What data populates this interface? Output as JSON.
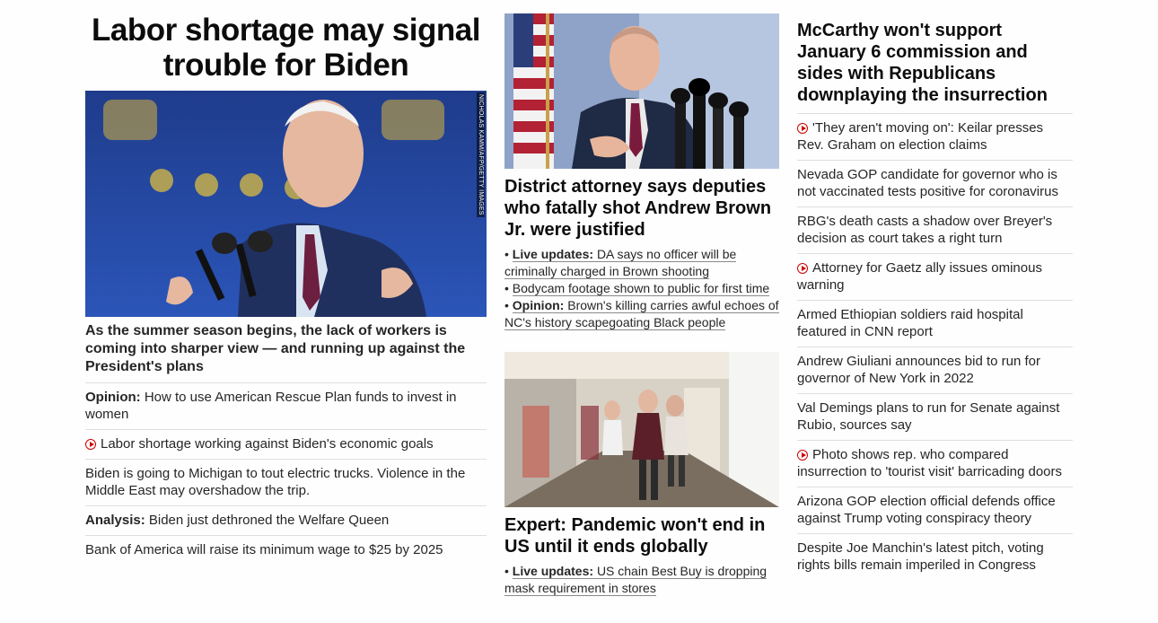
{
  "lead": {
    "headline": "Labor shortage may signal trouble for Biden",
    "photo_credit": "NICHOLAS KAMM/AFP/GETTY IMAGES",
    "summary": "As the summer season begins, the lack of workers is coming into sharper view — and running up against the President's plans",
    "links": [
      {
        "prefix": "Opinion:",
        "text": "How to use American Rescue Plan funds to invest in women",
        "video": false
      },
      {
        "prefix": "",
        "text": "Labor shortage working against Biden's economic goals",
        "video": true
      },
      {
        "prefix": "",
        "text": "Biden is going to Michigan to tout electric trucks. Violence in the Middle East may overshadow the trip.",
        "video": false
      },
      {
        "prefix": "Analysis:",
        "text": "Biden just dethroned the Welfare Queen",
        "video": false
      },
      {
        "prefix": "",
        "text": "Bank of America will raise its minimum wage to $25 by 2025",
        "video": false
      }
    ]
  },
  "middle": {
    "story1": {
      "headline": "District attorney says deputies who fatally shot Andrew Brown Jr. were justified",
      "bullets": [
        {
          "prefix": "Live updates:",
          "text": "DA says no officer will be criminally charged in Brown shooting"
        },
        {
          "prefix": "",
          "text": "Bodycam footage shown to public for first time"
        },
        {
          "prefix": "Opinion:",
          "text": "Brown's killing carries awful echoes of NC's history scapegoating Black people"
        }
      ]
    },
    "story2": {
      "headline": "Expert: Pandemic won't end in US until it ends globally",
      "bullets": [
        {
          "prefix": "Live updates:",
          "text": "US chain Best Buy is dropping mask requirement in stores"
        }
      ]
    }
  },
  "right": {
    "headline": "McCarthy won't support January 6 commission and sides with Republicans downplaying the insurrection",
    "links": [
      {
        "text": "'They aren't moving on': Keilar presses Rev. Graham on election claims",
        "video": true
      },
      {
        "text": "Nevada GOP candidate for governor who is not vaccinated tests positive for coronavirus",
        "video": false
      },
      {
        "text": "RBG's death casts a shadow over Breyer's decision as court takes a right turn",
        "video": false
      },
      {
        "text": "Attorney for Gaetz ally issues ominous warning",
        "video": true
      },
      {
        "text": "Armed Ethiopian soldiers raid hospital featured in CNN report",
        "video": false
      },
      {
        "text": "Andrew Giuliani announces bid to run for governor of New York in 2022",
        "video": false
      },
      {
        "text": "Val Demings plans to run for Senate against Rubio, sources say",
        "video": false
      },
      {
        "text": "Photo shows rep. who compared insurrection to 'tourist visit' barricading doors",
        "video": true
      },
      {
        "text": "Arizona GOP election official defends office against Trump voting conspiracy theory",
        "video": false
      },
      {
        "text": "Despite Joe Manchin's latest pitch, voting rights bills remain imperiled in Congress",
        "video": false
      }
    ]
  },
  "colors": {
    "accent_red": "#cc0000",
    "text": "#262626",
    "divider": "#dedede"
  }
}
